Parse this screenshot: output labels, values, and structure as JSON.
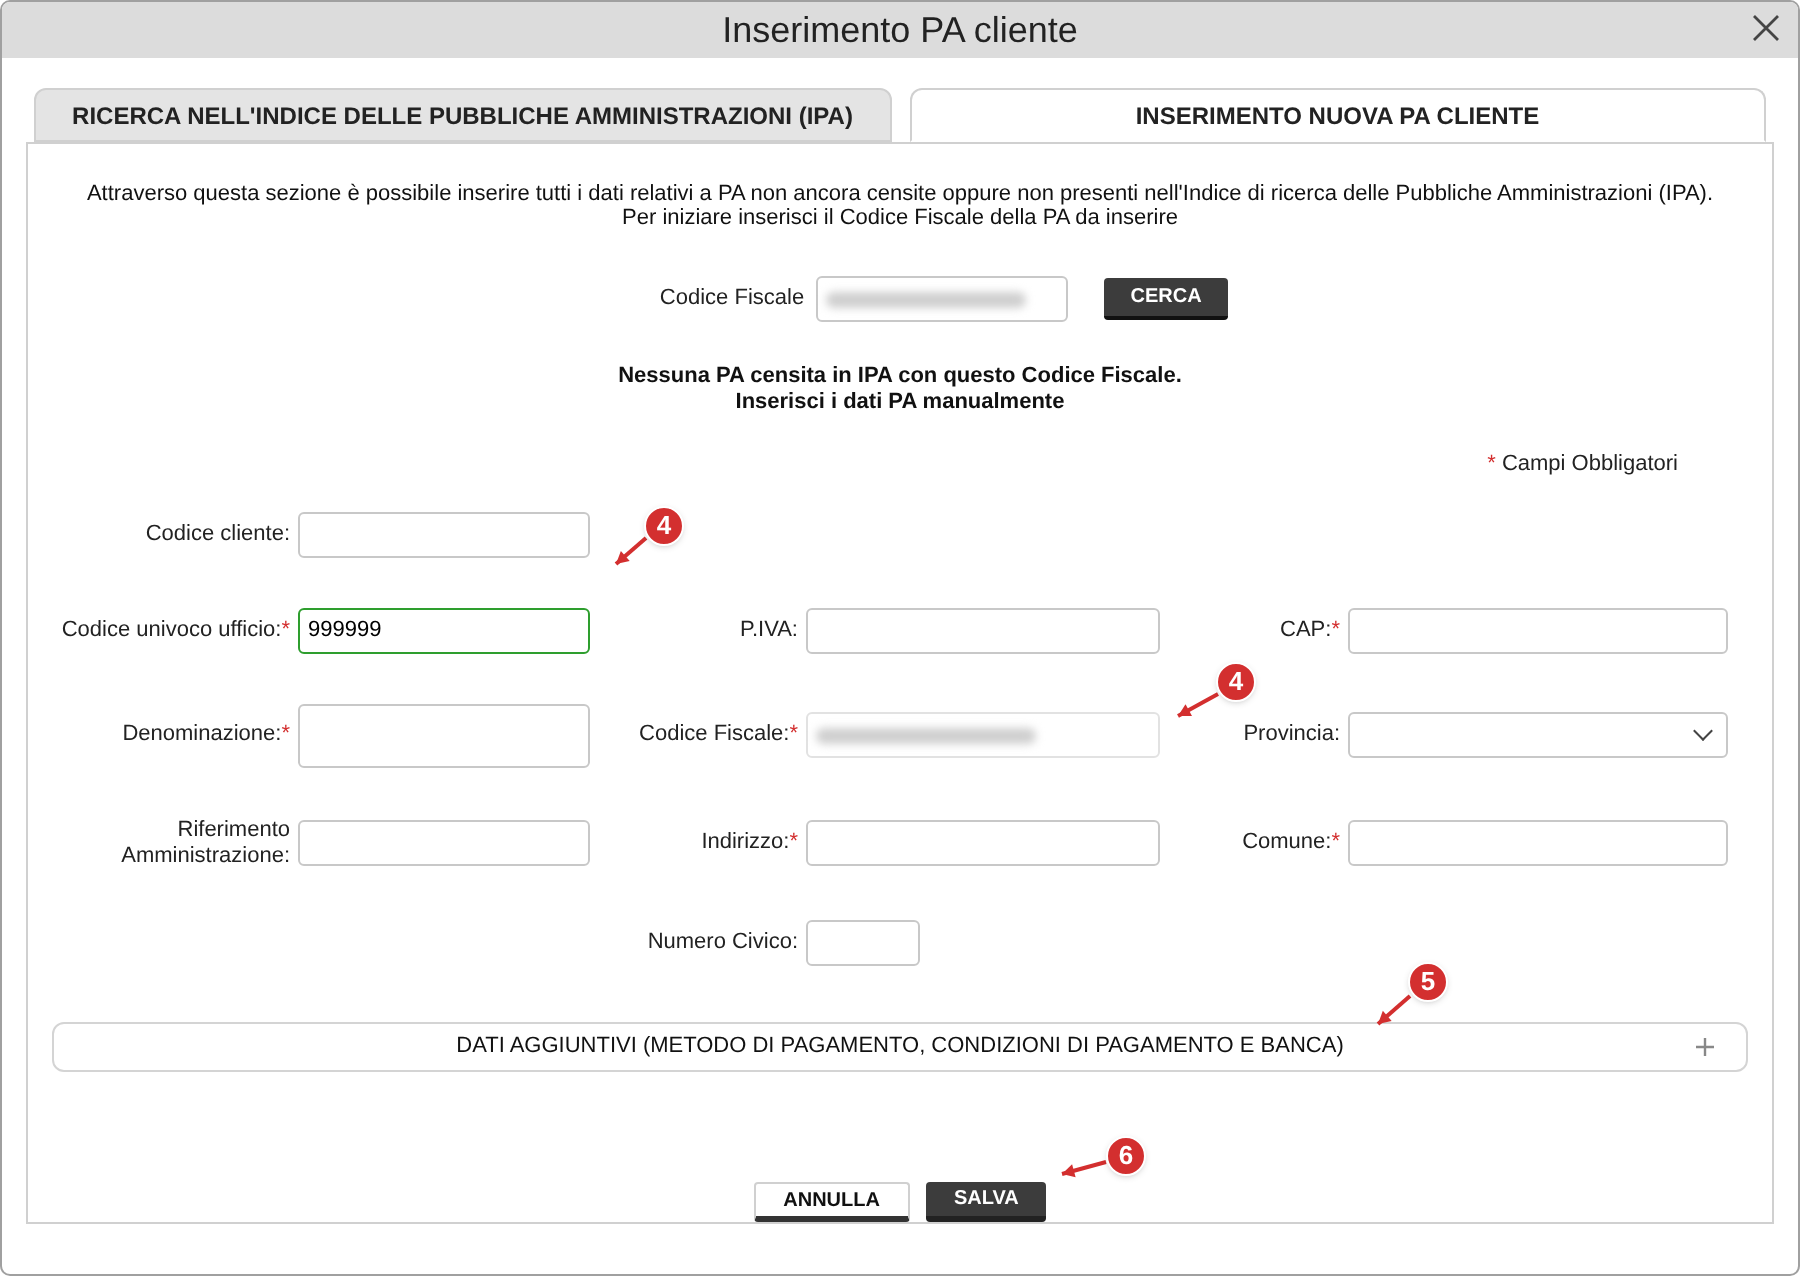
{
  "window": {
    "title": "Inserimento PA cliente"
  },
  "tabs": [
    {
      "label": "RICERCA NELL'INDICE DELLE PUBBLICHE AMMINISTRAZIONI (IPA)",
      "selected": false
    },
    {
      "label": "INSERIMENTO NUOVA PA CLIENTE",
      "selected": true
    }
  ],
  "intro": [
    "Attraverso questa sezione è possibile inserire tutti i dati relativi a PA non ancora censite oppure non presenti nell'Indice di ricerca delle Pubbliche Amministrazioni (IPA).",
    "Per iniziare inserisci il Codice Fiscale della PA da inserire"
  ],
  "search": {
    "label": "Codice Fiscale",
    "redacted": true,
    "button": "CERCA"
  },
  "result": [
    "Nessuna PA censita in IPA con questo Codice Fiscale.",
    "Inserisci i dati PA manualmente"
  ],
  "required_note": {
    "mark": "*",
    "text": "Campi Obbligatori"
  },
  "rows": [
    {
      "left": {
        "label": "Codice cliente:",
        "required": false,
        "kind": "text"
      }
    },
    {
      "left": {
        "label": "Codice univoco ufficio:",
        "required": true,
        "kind": "text",
        "value": "999999",
        "valid": true
      },
      "middle": {
        "label": "P.IVA:",
        "required": false,
        "kind": "text"
      },
      "right": {
        "label": "CAP:",
        "required": true,
        "kind": "text"
      }
    },
    {
      "left": {
        "label": "Denominazione:",
        "required": true,
        "kind": "textarea"
      },
      "middle": {
        "label": "Codice Fiscale:",
        "required": true,
        "kind": "text",
        "redacted": true
      },
      "right": {
        "label": "Provincia:",
        "required": false,
        "kind": "select"
      }
    },
    {
      "left": {
        "label": "Riferimento Amministrazione:",
        "required": false,
        "kind": "text"
      },
      "middle": {
        "label": "Indirizzo:",
        "required": true,
        "kind": "text"
      },
      "right": {
        "label": "Comune:",
        "required": true,
        "kind": "text"
      }
    },
    {
      "middle": {
        "label": "Numero Civico:",
        "required": false,
        "kind": "short"
      }
    }
  ],
  "accordion": {
    "label": "DATI AGGIUNTIVI (METODO DI PAGAMENTO, CONDIZIONI DI PAGAMENTO E BANCA)",
    "expanded": false
  },
  "buttons": [
    {
      "label": "ANNULLA",
      "kind": "secondary"
    },
    {
      "label": "SALVA",
      "kind": "primary"
    }
  ],
  "callouts": [
    "4",
    "4",
    "5",
    "6"
  ]
}
